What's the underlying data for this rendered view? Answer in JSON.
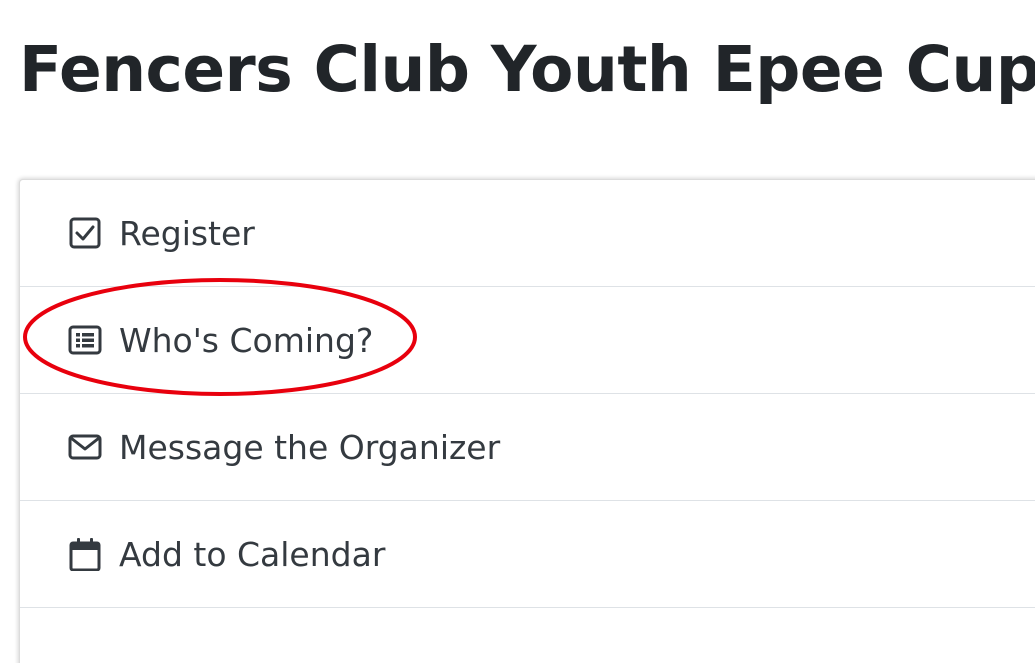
{
  "page": {
    "title": "Fencers Club Youth Epee Cup"
  },
  "menu": {
    "items": [
      {
        "label": "Register",
        "icon": "checkbox-checked-icon"
      },
      {
        "label": "Who's Coming?",
        "icon": "list-icon"
      },
      {
        "label": "Message the Organizer",
        "icon": "envelope-icon"
      },
      {
        "label": "Add to Calendar",
        "icon": "calendar-icon"
      }
    ]
  },
  "annotation": {
    "highlighted_item": "Who's Coming?",
    "color": "#e8000d"
  },
  "colors": {
    "text": "#212529",
    "item_text": "#343a40",
    "divider": "#dee2e6",
    "highlight": "#e8000d"
  }
}
